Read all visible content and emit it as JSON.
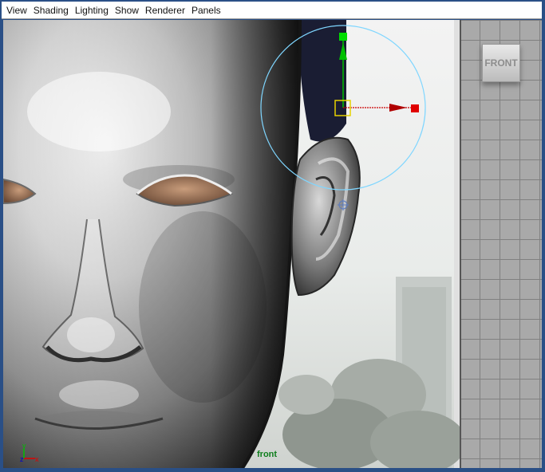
{
  "menubar": {
    "items": [
      "View",
      "Shading",
      "Lighting",
      "Show",
      "Renderer",
      "Panels"
    ]
  },
  "viewport": {
    "camera_label": "front",
    "viewcube_label": "FRONT",
    "axis": {
      "y": "y",
      "z": "z",
      "x": "x"
    }
  },
  "colors": {
    "menubar_bg": "#ffffff",
    "frame": "#2a4f86",
    "grid_bg": "#a9a9a9",
    "camera_label": "#0e7e1c",
    "move_y_handle": "#00c000",
    "move_x_handle": "#e00000",
    "rotate_ring": "#7fd6ff",
    "pivot_box": "#e6d200"
  },
  "icons": [
    "move-manipulator-icon",
    "pivot-icon",
    "axis-indicator-icon"
  ]
}
